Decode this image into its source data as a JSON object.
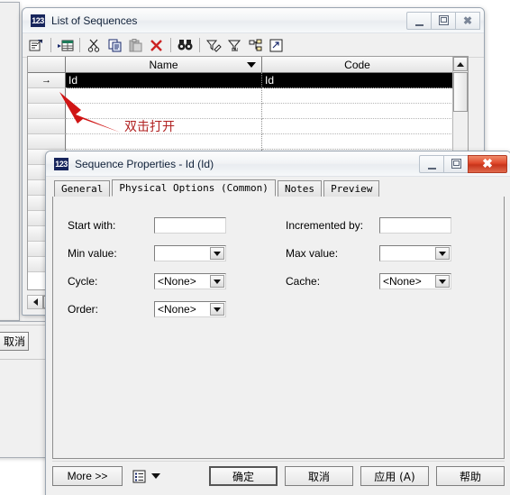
{
  "list_window": {
    "title": "List of Sequences",
    "icon": "123",
    "controls": {
      "minimize": "minimize-icon",
      "restore": "restore-icon",
      "close": "close-icon",
      "close_glyph": "✖"
    },
    "toolbar": [
      {
        "name": "properties-icon",
        "glyph": "⚙"
      },
      {
        "name": "new-sequence-icon",
        "glyph": "▤"
      },
      {
        "name": "cut-icon",
        "glyph": "✂"
      },
      {
        "name": "copy-icon",
        "glyph": "⧉"
      },
      {
        "name": "paste-icon",
        "glyph": "⎘"
      },
      {
        "name": "delete-icon",
        "glyph": "✕"
      },
      {
        "name": "find-icon",
        "glyph": "ʘʘ"
      },
      {
        "name": "edit-filter-icon",
        "glyph": "∇"
      },
      {
        "name": "remove-filter-icon",
        "glyph": "∇"
      },
      {
        "name": "hierarchy-icon",
        "glyph": "⑂"
      },
      {
        "name": "open-external-icon",
        "glyph": "↗"
      }
    ],
    "grid": {
      "columns": [
        "Name",
        "Code"
      ],
      "rows": [
        {
          "selected": true,
          "marker": "→",
          "Name": "Id",
          "Code": "Id"
        },
        {
          "selected": false,
          "marker": "",
          "Name": "",
          "Code": ""
        },
        {
          "selected": false,
          "marker": "",
          "Name": "",
          "Code": ""
        },
        {
          "selected": false,
          "marker": "",
          "Name": "",
          "Code": ""
        },
        {
          "selected": false,
          "marker": "",
          "Name": "",
          "Code": ""
        },
        {
          "selected": false,
          "marker": "",
          "Name": "",
          "Code": ""
        },
        {
          "selected": false,
          "marker": "",
          "Name": "",
          "Code": ""
        },
        {
          "selected": false,
          "marker": "",
          "Name": "",
          "Code": ""
        },
        {
          "selected": false,
          "marker": "",
          "Name": "",
          "Code": ""
        },
        {
          "selected": false,
          "marker": "",
          "Name": "",
          "Code": ""
        },
        {
          "selected": false,
          "marker": "",
          "Name": "",
          "Code": ""
        },
        {
          "selected": false,
          "marker": "",
          "Name": "",
          "Code": ""
        },
        {
          "selected": false,
          "marker": "",
          "Name": "",
          "Code": ""
        }
      ]
    }
  },
  "annotation": {
    "text": "双击打开",
    "color": "#cc0000"
  },
  "props_window": {
    "title": "Sequence Properties - Id (Id)",
    "icon": "123",
    "controls": {
      "minimize": "minimize-icon",
      "restore": "restore-icon",
      "close": "close-icon",
      "close_glyph": "✖"
    },
    "tabs": [
      {
        "label": "General",
        "active": false
      },
      {
        "label": "Physical Options (Common)",
        "active": true
      },
      {
        "label": "Notes",
        "active": false
      },
      {
        "label": "Preview",
        "active": false
      }
    ],
    "fields": {
      "start_with": {
        "label": "Start with:",
        "value": "",
        "type": "text"
      },
      "incremented_by": {
        "label": "Incremented by:",
        "value": "",
        "type": "text"
      },
      "min_value": {
        "label": "Min value:",
        "value": "",
        "type": "combo"
      },
      "max_value": {
        "label": "Max value:",
        "value": "",
        "type": "combo"
      },
      "cycle": {
        "label": "Cycle:",
        "value": "<None>",
        "type": "combo"
      },
      "cache": {
        "label": "Cache:",
        "value": "<None>",
        "type": "combo"
      },
      "order": {
        "label": "Order:",
        "value": "<None>",
        "type": "combo"
      }
    },
    "footer": {
      "more": "More >>",
      "menu_icon": "list-menu-icon",
      "ok": "确定",
      "cancel": "取消",
      "apply": "应用 (A)",
      "help": "帮助"
    }
  },
  "background": {
    "cancel_partial": "取消"
  }
}
